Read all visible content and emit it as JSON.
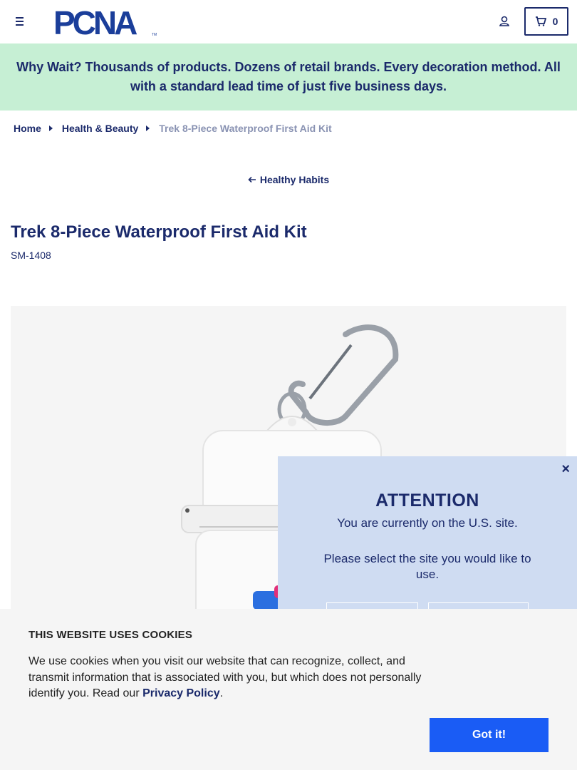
{
  "header": {
    "logo_text": "PCNA",
    "logo_tm": "TM",
    "cart_count": "0"
  },
  "banner": {
    "text": "Why Wait? Thousands of products. Dozens of retail brands. Every decoration method. All with a standard lead time of just five business days."
  },
  "breadcrumb": {
    "home": "Home",
    "category": "Health & Beauty",
    "current": "Trek 8-Piece Waterproof First Aid Kit"
  },
  "back_link": {
    "label": "Healthy Habits"
  },
  "product": {
    "title": "Trek 8-Piece Waterproof First Aid Kit",
    "sku": "SM-1408"
  },
  "attention": {
    "title": "ATTENTION",
    "line1": "You are currently on the U.S. site.",
    "line2": "Please select the site you would like to use.",
    "close": "×"
  },
  "cookie": {
    "title": "THIS WEBSITE USES COOKIES",
    "text_before": "We use cookies when you visit our website that can recognize, collect, and transmit information that is associated with you, but which does not personally identify you. Read our ",
    "link": "Privacy Policy",
    "text_after": ".",
    "button": "Got it!"
  },
  "colors": {
    "navy": "#1b2a6b",
    "banner_bg": "#c6efd4",
    "modal_bg": "#cfdcf2",
    "cookie_bg": "#f5f5f5",
    "button_blue": "#1a5cf5"
  },
  "icons": [
    "menu-icon",
    "user-icon",
    "cart-icon",
    "chevron-right-icon",
    "arrow-left-icon",
    "close-icon"
  ]
}
